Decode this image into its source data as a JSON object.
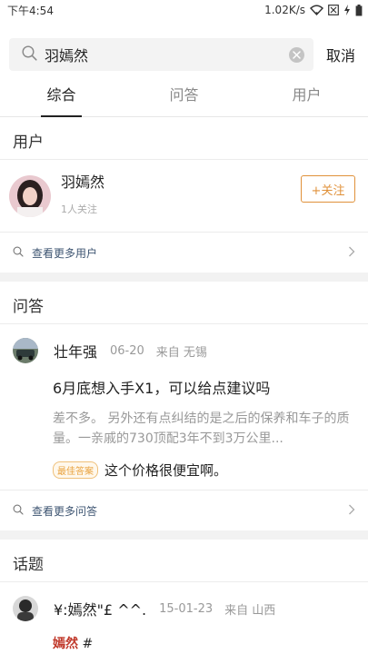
{
  "status_bar": {
    "time": "下午4:54",
    "speed": "1.02K/s"
  },
  "search": {
    "query": "羽嫣然",
    "cancel_label": "取消"
  },
  "tabs": [
    {
      "label": "综合"
    },
    {
      "label": "问答"
    },
    {
      "label": "用户"
    }
  ],
  "users_section": {
    "title": "用户",
    "user": {
      "name": "羽嫣然",
      "followers": "1人关注",
      "follow_label": "+关注"
    },
    "more_label": "查看更多用户"
  },
  "qa_section": {
    "title": "问答",
    "item": {
      "author": "壮年强",
      "date": "06-20",
      "source": "来自 无锡",
      "question": "6月底想入手X1，可以给点建议吗",
      "snippet": "差不多。 另外还有点纠结的是之后的保养和车子的质量。一亲戚的730顶配3年不到3万公里...",
      "best_badge": "最佳答案",
      "best_answer": "这个价格很便宜啊。"
    },
    "more_label": "查看更多问答"
  },
  "topics_section": {
    "title": "话题",
    "item": {
      "author": "¥:嫣然\"£ ^^.",
      "date": "15-01-23",
      "source": "来自 山西",
      "highlight": "嫣然",
      "rest": "#"
    }
  }
}
